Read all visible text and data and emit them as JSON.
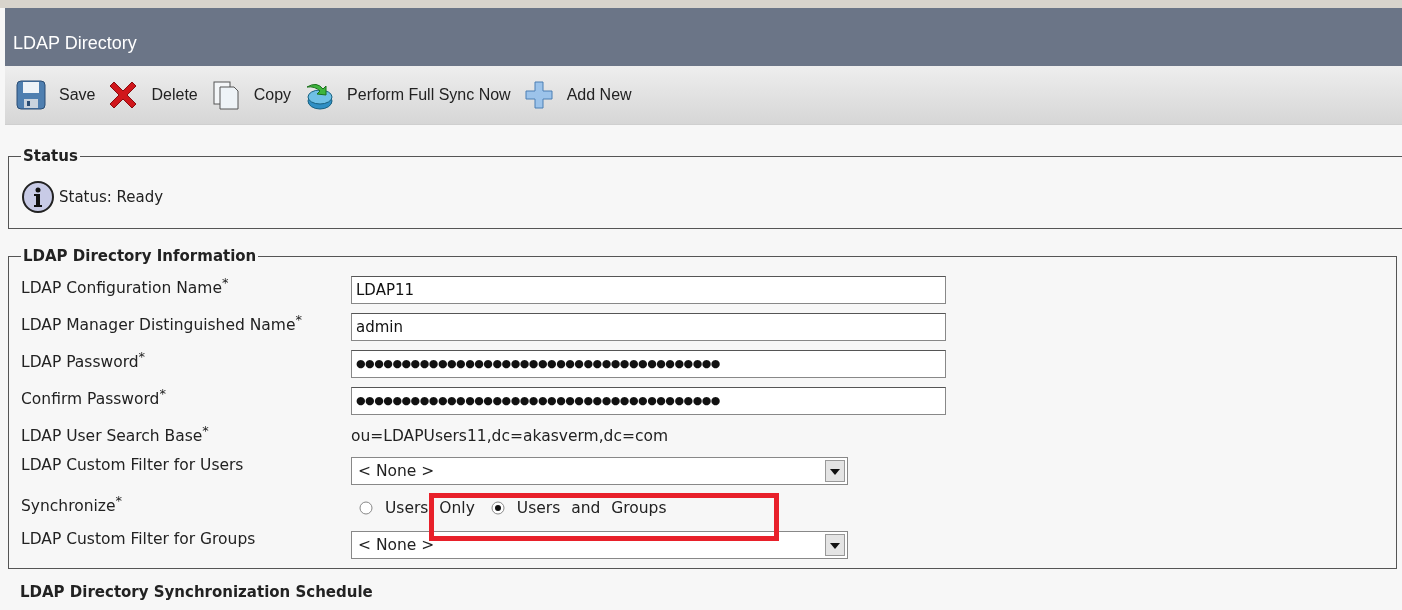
{
  "window": {
    "title": "LDAP Directory"
  },
  "toolbar": [
    {
      "kind": "save",
      "label": "Save"
    },
    {
      "kind": "delete",
      "label": "Delete"
    },
    {
      "kind": "copy",
      "label": "Copy"
    },
    {
      "kind": "sync",
      "label": "Perform Full Sync Now"
    },
    {
      "kind": "add",
      "label": "Add New"
    }
  ],
  "status": {
    "title": "Status",
    "text": "Status: Ready"
  },
  "ldap_info": {
    "title": "LDAP Directory Information",
    "rows": [
      {
        "kind": "text",
        "label": "LDAP Configuration Name",
        "mark": "*",
        "value": "LDAP11"
      },
      {
        "kind": "text",
        "label": "LDAP Manager Distinguished Name",
        "mark": "*",
        "value": "admin"
      },
      {
        "kind": "password",
        "label": "LDAP Password",
        "mark": "*",
        "value": "●●●●●●●●●●●●●●●●●●●●●●●●●●●●●●●●●●●●●●●●"
      },
      {
        "kind": "password",
        "label": "Confirm Password",
        "mark": "*",
        "value": "●●●●●●●●●●●●●●●●●●●●●●●●●●●●●●●●●●●●●●●●"
      },
      {
        "kind": "static",
        "label": "LDAP User Search Base",
        "mark": "*",
        "value": "ou=LDAPUsers11,dc=akasverm,dc=com"
      },
      {
        "kind": "select",
        "label": "LDAP Custom Filter for Users",
        "value": "< None >"
      },
      {
        "kind": "radio",
        "label": "Synchronize",
        "mark": "*",
        "options": [
          {
            "label": "Users Only",
            "selected": false
          },
          {
            "label": "Users and Groups",
            "selected": true
          }
        ]
      },
      {
        "kind": "select",
        "label": "LDAP Custom Filter for Groups",
        "value": "< None >"
      }
    ]
  },
  "next_section": {
    "title": "LDAP Directory Synchronization Schedule"
  }
}
